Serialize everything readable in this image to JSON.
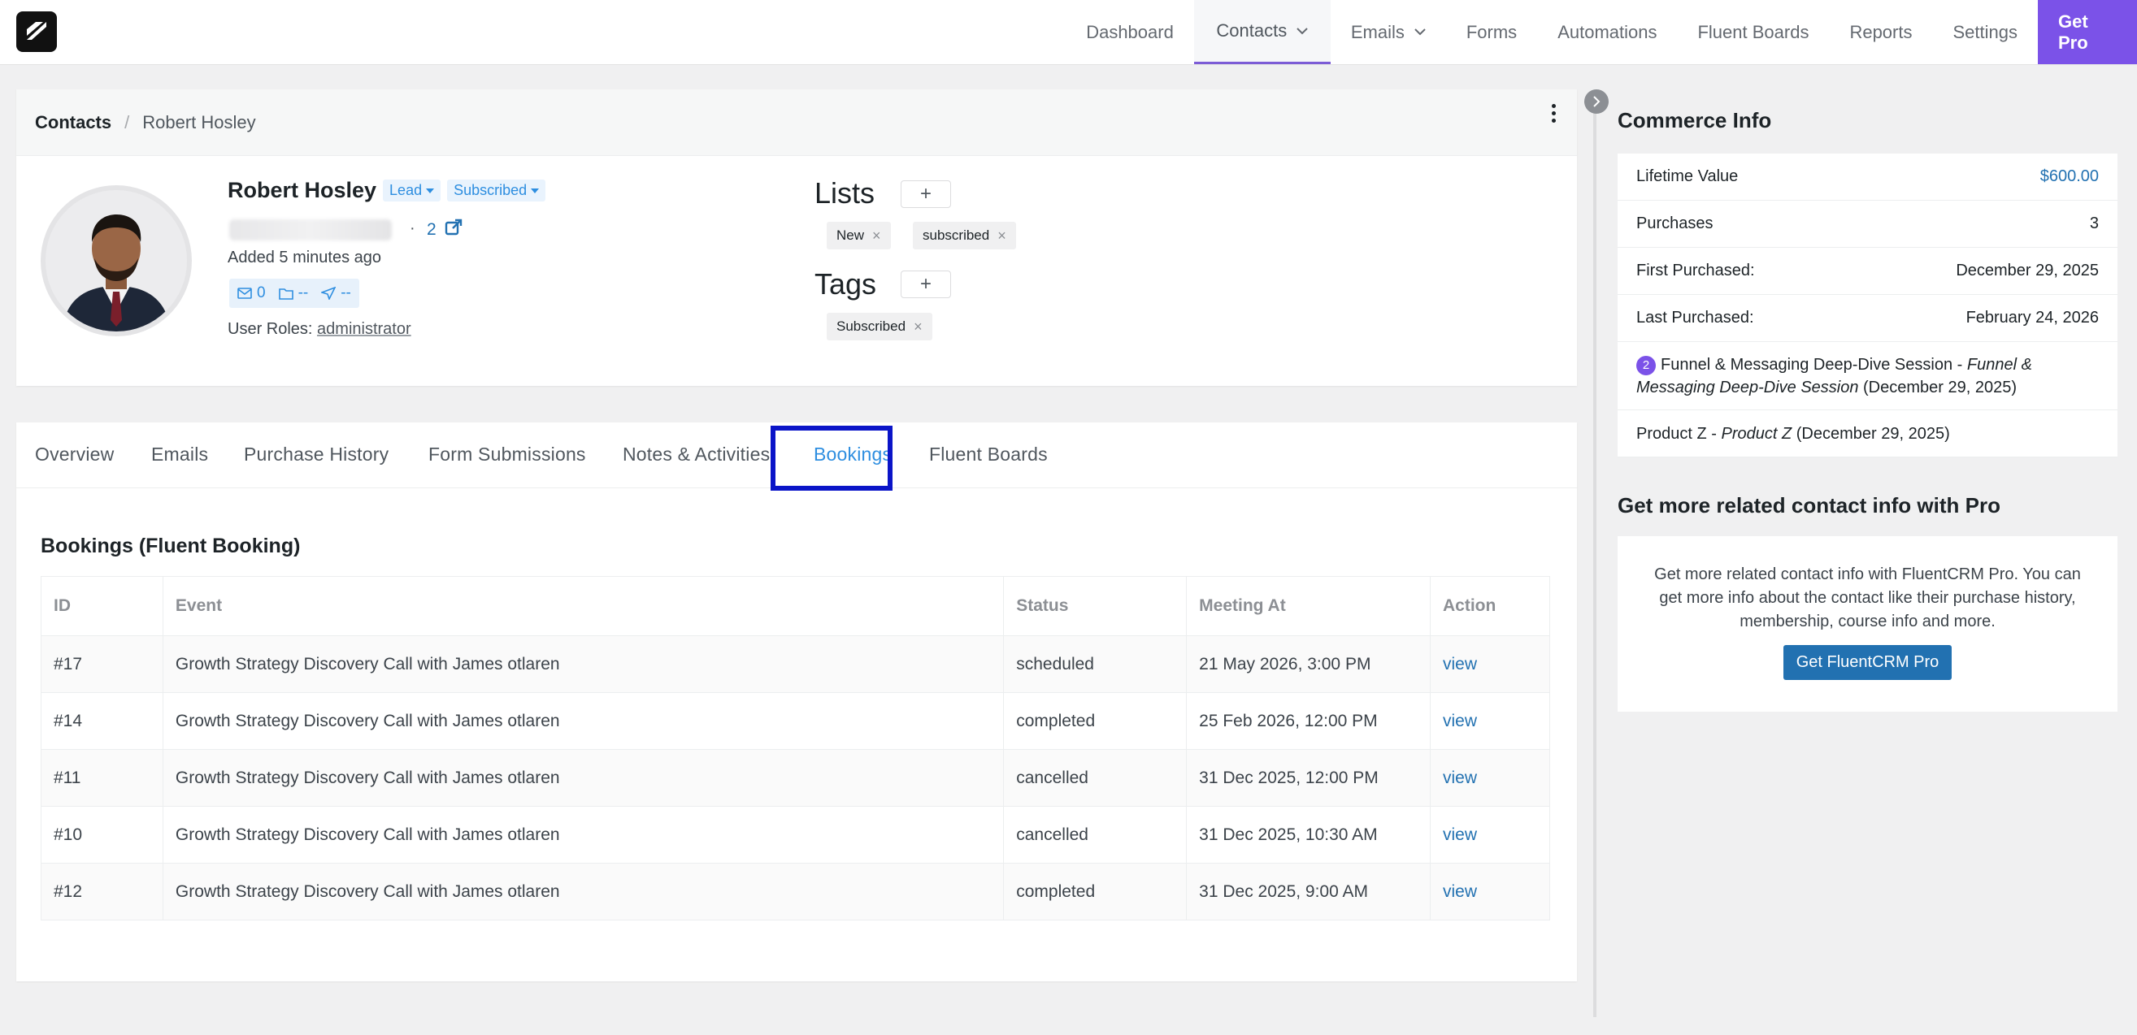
{
  "nav": {
    "items": [
      {
        "label": "Dashboard",
        "key": "dashboard"
      },
      {
        "label": "Contacts",
        "key": "contacts",
        "active": true,
        "dropdown": true
      },
      {
        "label": "Emails",
        "key": "emails",
        "dropdown": true
      },
      {
        "label": "Forms",
        "key": "forms"
      },
      {
        "label": "Automations",
        "key": "automations"
      },
      {
        "label": "Fluent Boards",
        "key": "fluent-boards"
      },
      {
        "label": "Reports",
        "key": "reports"
      },
      {
        "label": "Settings",
        "key": "settings"
      }
    ],
    "get_pro": "Get Pro"
  },
  "breadcrumb": {
    "root": "Contacts",
    "separator": "/",
    "current": "Robert Hosley"
  },
  "profile": {
    "name": "Robert Hosley",
    "status_lead": "Lead",
    "status_subscribed": "Subscribed",
    "separator": "·",
    "count": "2",
    "added": "Added 5 minutes ago",
    "stats": {
      "emails": "0",
      "folder": "--",
      "send": "--"
    },
    "roles_label": "User Roles:",
    "roles_value": "administrator"
  },
  "lists": {
    "title": "Lists",
    "add": "+",
    "items": [
      "New",
      "subscribed"
    ]
  },
  "tags": {
    "title": "Tags",
    "add": "+",
    "items": [
      "Subscribed"
    ]
  },
  "tabs": [
    "Overview",
    "Emails",
    "Purchase History",
    "Form Submissions",
    "Notes & Activities",
    "Bookings",
    "Fluent Boards"
  ],
  "active_tab": "Bookings",
  "bookings": {
    "title": "Bookings (Fluent Booking)",
    "columns": [
      "ID",
      "Event",
      "Status",
      "Meeting At",
      "Action"
    ],
    "rows": [
      {
        "id": "#17",
        "event": "Growth Strategy Discovery Call with James otlaren",
        "status": "scheduled",
        "meeting_at": "21 May 2026, 3:00 PM",
        "action": "view"
      },
      {
        "id": "#14",
        "event": "Growth Strategy Discovery Call with James otlaren",
        "status": "completed",
        "meeting_at": "25 Feb 2026, 12:00 PM",
        "action": "view"
      },
      {
        "id": "#11",
        "event": "Growth Strategy Discovery Call with James otlaren",
        "status": "cancelled",
        "meeting_at": "31 Dec 2025, 12:00 PM",
        "action": "view"
      },
      {
        "id": "#10",
        "event": "Growth Strategy Discovery Call with James otlaren",
        "status": "cancelled",
        "meeting_at": "31 Dec 2025, 10:30 AM",
        "action": "view"
      },
      {
        "id": "#12",
        "event": "Growth Strategy Discovery Call with James otlaren",
        "status": "completed",
        "meeting_at": "31 Dec 2025, 9:00 AM",
        "action": "view"
      }
    ]
  },
  "commerce": {
    "title": "Commerce Info",
    "rows": [
      {
        "label": "Lifetime Value",
        "value": "$600.00"
      },
      {
        "label": "Purchases",
        "value": "3"
      },
      {
        "label": "First Purchased:",
        "value": "December 29, 2025"
      },
      {
        "label": "Last Purchased:",
        "value": "February 24, 2026"
      }
    ],
    "products": [
      {
        "badge": "2",
        "name": "Funnel & Messaging Deep-Dive Session",
        "sep": " - ",
        "variant": "Funnel & Messaging Deep-Dive Session",
        "date": " (December 29, 2025)"
      },
      {
        "badge": "",
        "name": "Product Z",
        "sep": " - ",
        "variant": "Product Z",
        "date": " (December 29, 2025)"
      }
    ]
  },
  "promo": {
    "title": "Get more related contact info with Pro",
    "text": "Get more related contact info with FluentCRM Pro. You can get more info about the contact like their purchase history, membership, course info and more.",
    "button": "Get FluentCRM Pro"
  },
  "colors": {
    "accent": "#7b52e8",
    "link": "#2271b1",
    "active_tab": "#2e8ee0",
    "highlight": "#0a14c8"
  }
}
